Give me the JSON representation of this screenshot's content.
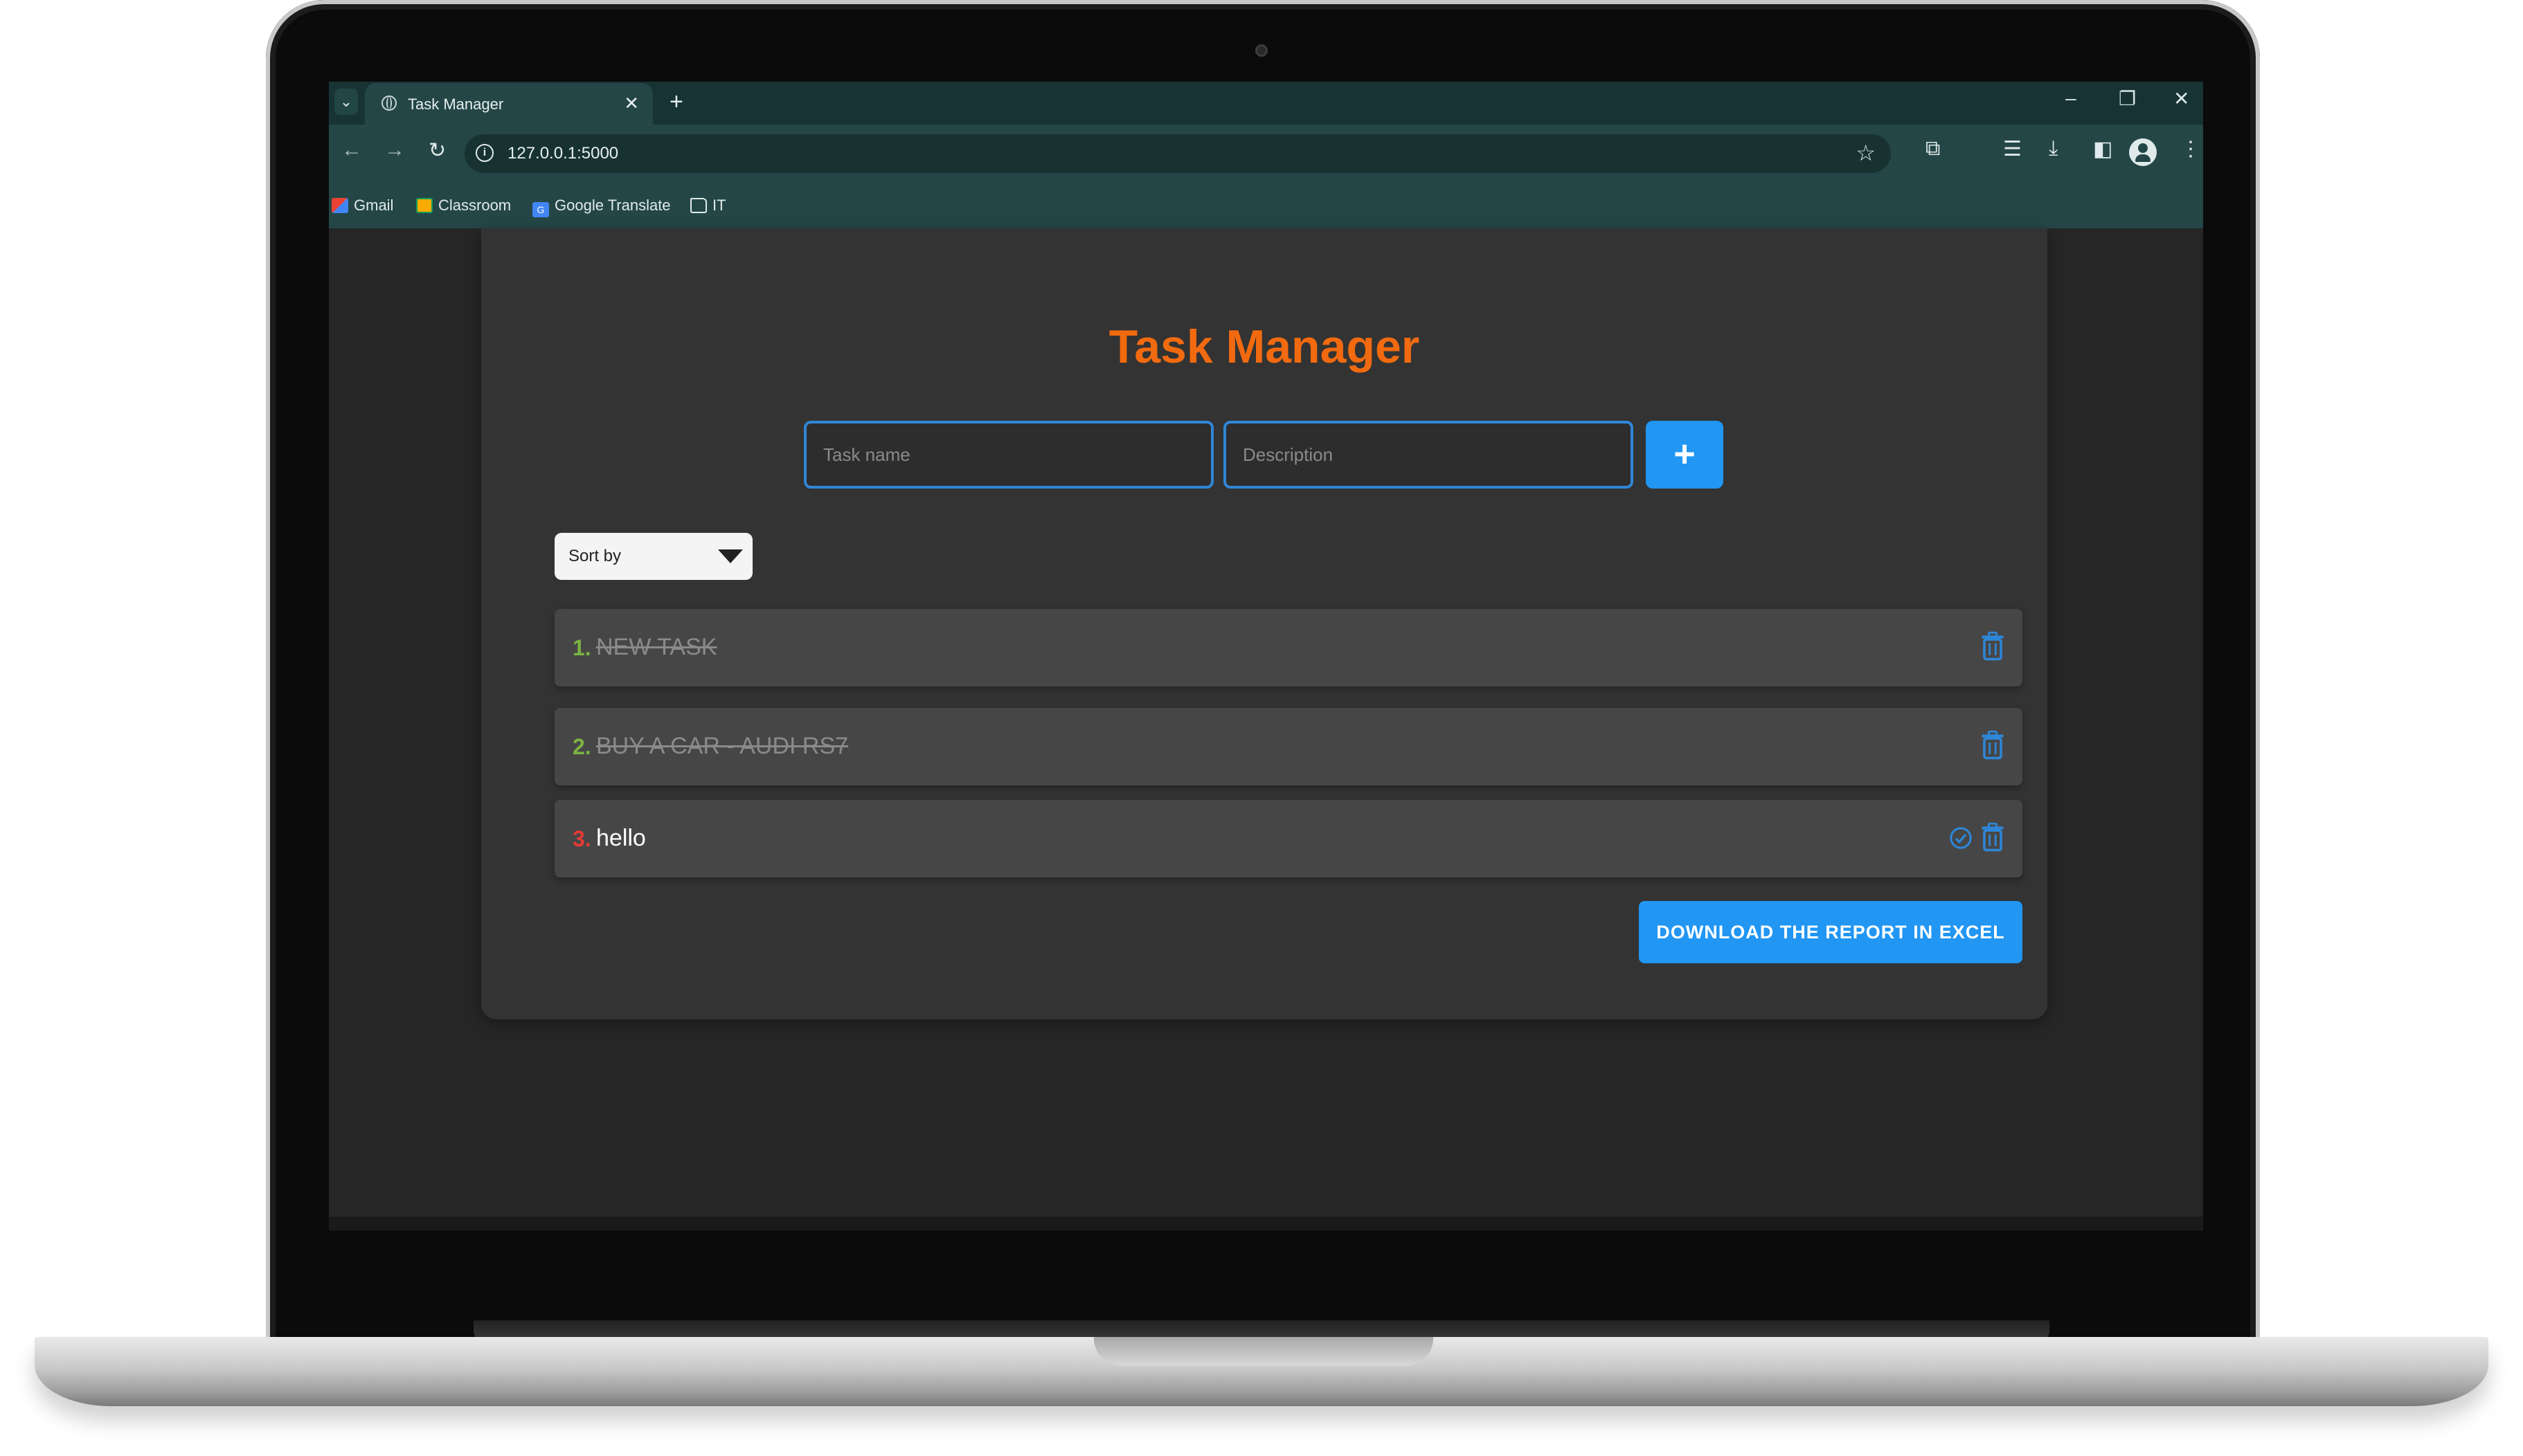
{
  "browser": {
    "tab_title": "Task Manager",
    "tab_close": "✕",
    "new_tab": "+",
    "url": "127.0.0.1:5000",
    "bookmarks": [
      {
        "label": "Gmail",
        "icon": "gmail-icon"
      },
      {
        "label": "Classroom",
        "icon": "classroom-icon"
      },
      {
        "label": "Google Translate",
        "icon": "google-translate-icon"
      },
      {
        "label": "IT",
        "icon": "folder-icon"
      }
    ]
  },
  "app": {
    "title": "Task Manager",
    "task_name_placeholder": "Task name",
    "description_placeholder": "Description",
    "add_label": "+",
    "sort_label": "Sort by",
    "tasks": [
      {
        "number": "1.",
        "text": "NEW TASK",
        "completed": true,
        "number_color": "#7cb342"
      },
      {
        "number": "2.",
        "text": "BUY A CAR - AUDI RS7",
        "completed": true,
        "number_color": "#7cb342"
      },
      {
        "number": "3.",
        "text": "hello",
        "completed": false,
        "number_color": "#e53935"
      }
    ],
    "download_label": "DOWNLOAD THE REPORT IN EXCEL"
  },
  "colors": {
    "accent": "#2196f3",
    "title": "#f26a0f",
    "card": "#333333",
    "task_row": "#464646"
  }
}
